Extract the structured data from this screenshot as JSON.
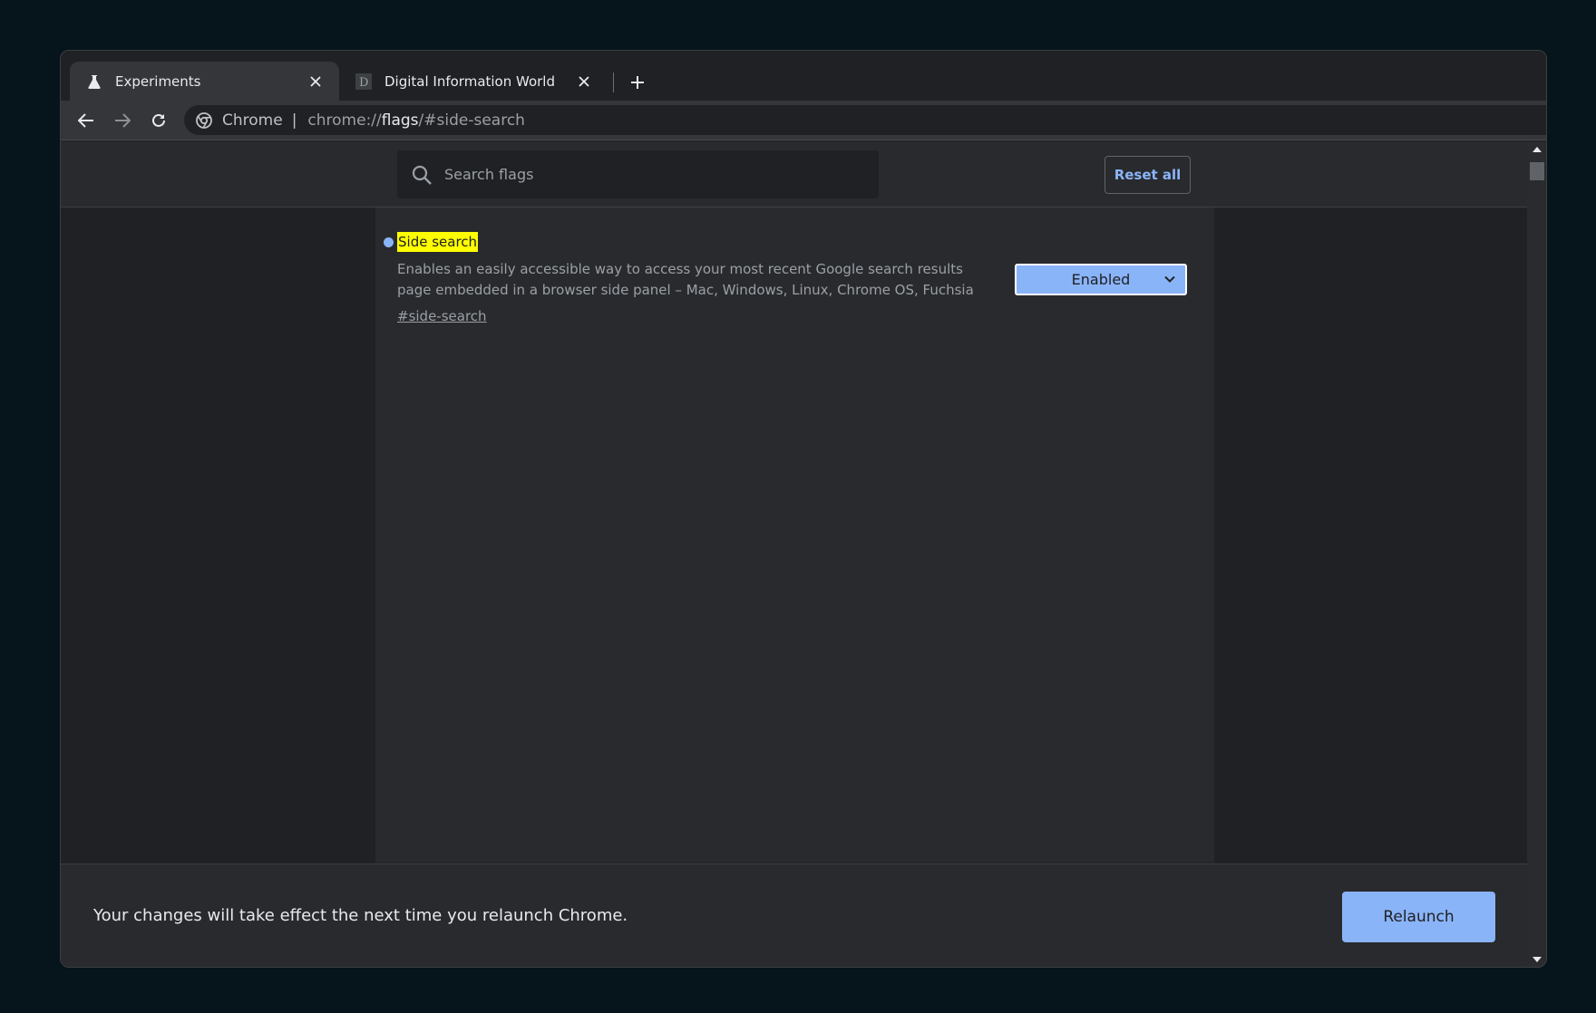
{
  "tabs": [
    {
      "title": "Experiments",
      "icon": "flask-icon",
      "active": true
    },
    {
      "title": "Digital Information World",
      "icon": "site-favicon-d",
      "active": false
    }
  ],
  "toolbar": {
    "chip_label": "Chrome",
    "url_scheme": "chrome://",
    "url_host": "flags",
    "url_rest": "/#side-search"
  },
  "search": {
    "placeholder": "Search flags",
    "value": ""
  },
  "reset_label": "Reset all",
  "flag": {
    "name": "Side search",
    "description": "Enables an easily accessible way to access your most recent Google search results page embedded in a browser side panel – Mac, Windows, Linux, Chrome OS, Fuchsia",
    "link": "#side-search",
    "state": "Enabled"
  },
  "relaunch": {
    "message": "Your changes will take effect the next time you relaunch Chrome.",
    "button": "Relaunch"
  },
  "colors": {
    "accent": "#8ab4f8",
    "highlight": "#ffff00",
    "background": "#202124"
  }
}
